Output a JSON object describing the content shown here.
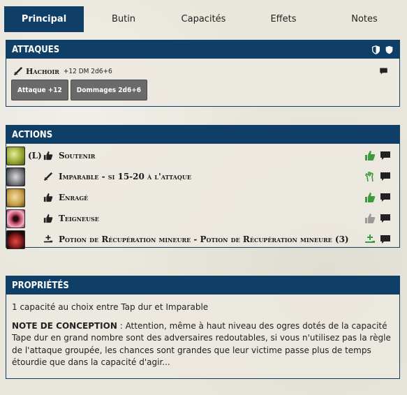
{
  "tabs": [
    {
      "label": "Principal",
      "active": true
    },
    {
      "label": "Butin"
    },
    {
      "label": "Capacités"
    },
    {
      "label": "Effets"
    },
    {
      "label": "Notes"
    }
  ],
  "attaques": {
    "title": "ATTAQUES",
    "attack": {
      "name": "Hachoir",
      "stats": "+12 DM 2d6+6",
      "icon": "sword-icon"
    },
    "buttons": [
      {
        "label": "Attaque +12"
      },
      {
        "label": "Dommages 2d6+6"
      }
    ]
  },
  "actions": {
    "title": "ACTIONS",
    "items": [
      {
        "tag": "(L)",
        "name": "Soutenir",
        "type_icon": "thumbs-up-icon",
        "state_icon": "thumbs-up-icon",
        "state_color": "#3d9a3d",
        "portrait_color": "#b7c24a"
      },
      {
        "tag": "",
        "name": "Imparable - si 15-20 à l'attaque",
        "type_icon": "sword-icon",
        "state_icon": "hand-outline-icon",
        "state_color": "#3d9a3d",
        "portrait_color": "#7d7f86"
      },
      {
        "tag": "",
        "name": "Enragé",
        "type_icon": "thumbs-up-icon",
        "state_icon": "thumbs-up-icon",
        "state_color": "#3d9a3d",
        "portrait_color": "#c9a24a"
      },
      {
        "tag": "",
        "name": "Teigneuse",
        "type_icon": "thumbs-up-icon",
        "state_icon": "thumbs-up-icon",
        "state_color": "#9a9a9a",
        "portrait_color": "#c04a6a"
      },
      {
        "tag": "",
        "name": "Potion de Récupération mineure - Potion de Récupération mineure (3)",
        "type_icon": "potion-hand-icon",
        "state_icon": "potion-hand-icon",
        "state_color": "#3d9a3d",
        "portrait_color": "#8a1a1a"
      }
    ]
  },
  "proprietes": {
    "title": "PROPRIÉTÉS",
    "line1": "1 capacité au choix entre Tap dur et Imparable",
    "note_label": "NOTE DE CONCEPTION",
    "note_text": " : Attention, même à haut niveau des ogres dotés de la capacité Tape dur en grand nombre sont des adversaires redoutables, si vous n'utilisez pas la règle de l'attaque groupée, les chances sont grandes que leur victime passe plus de temps étourdie que dans la capacité d'agir..."
  }
}
